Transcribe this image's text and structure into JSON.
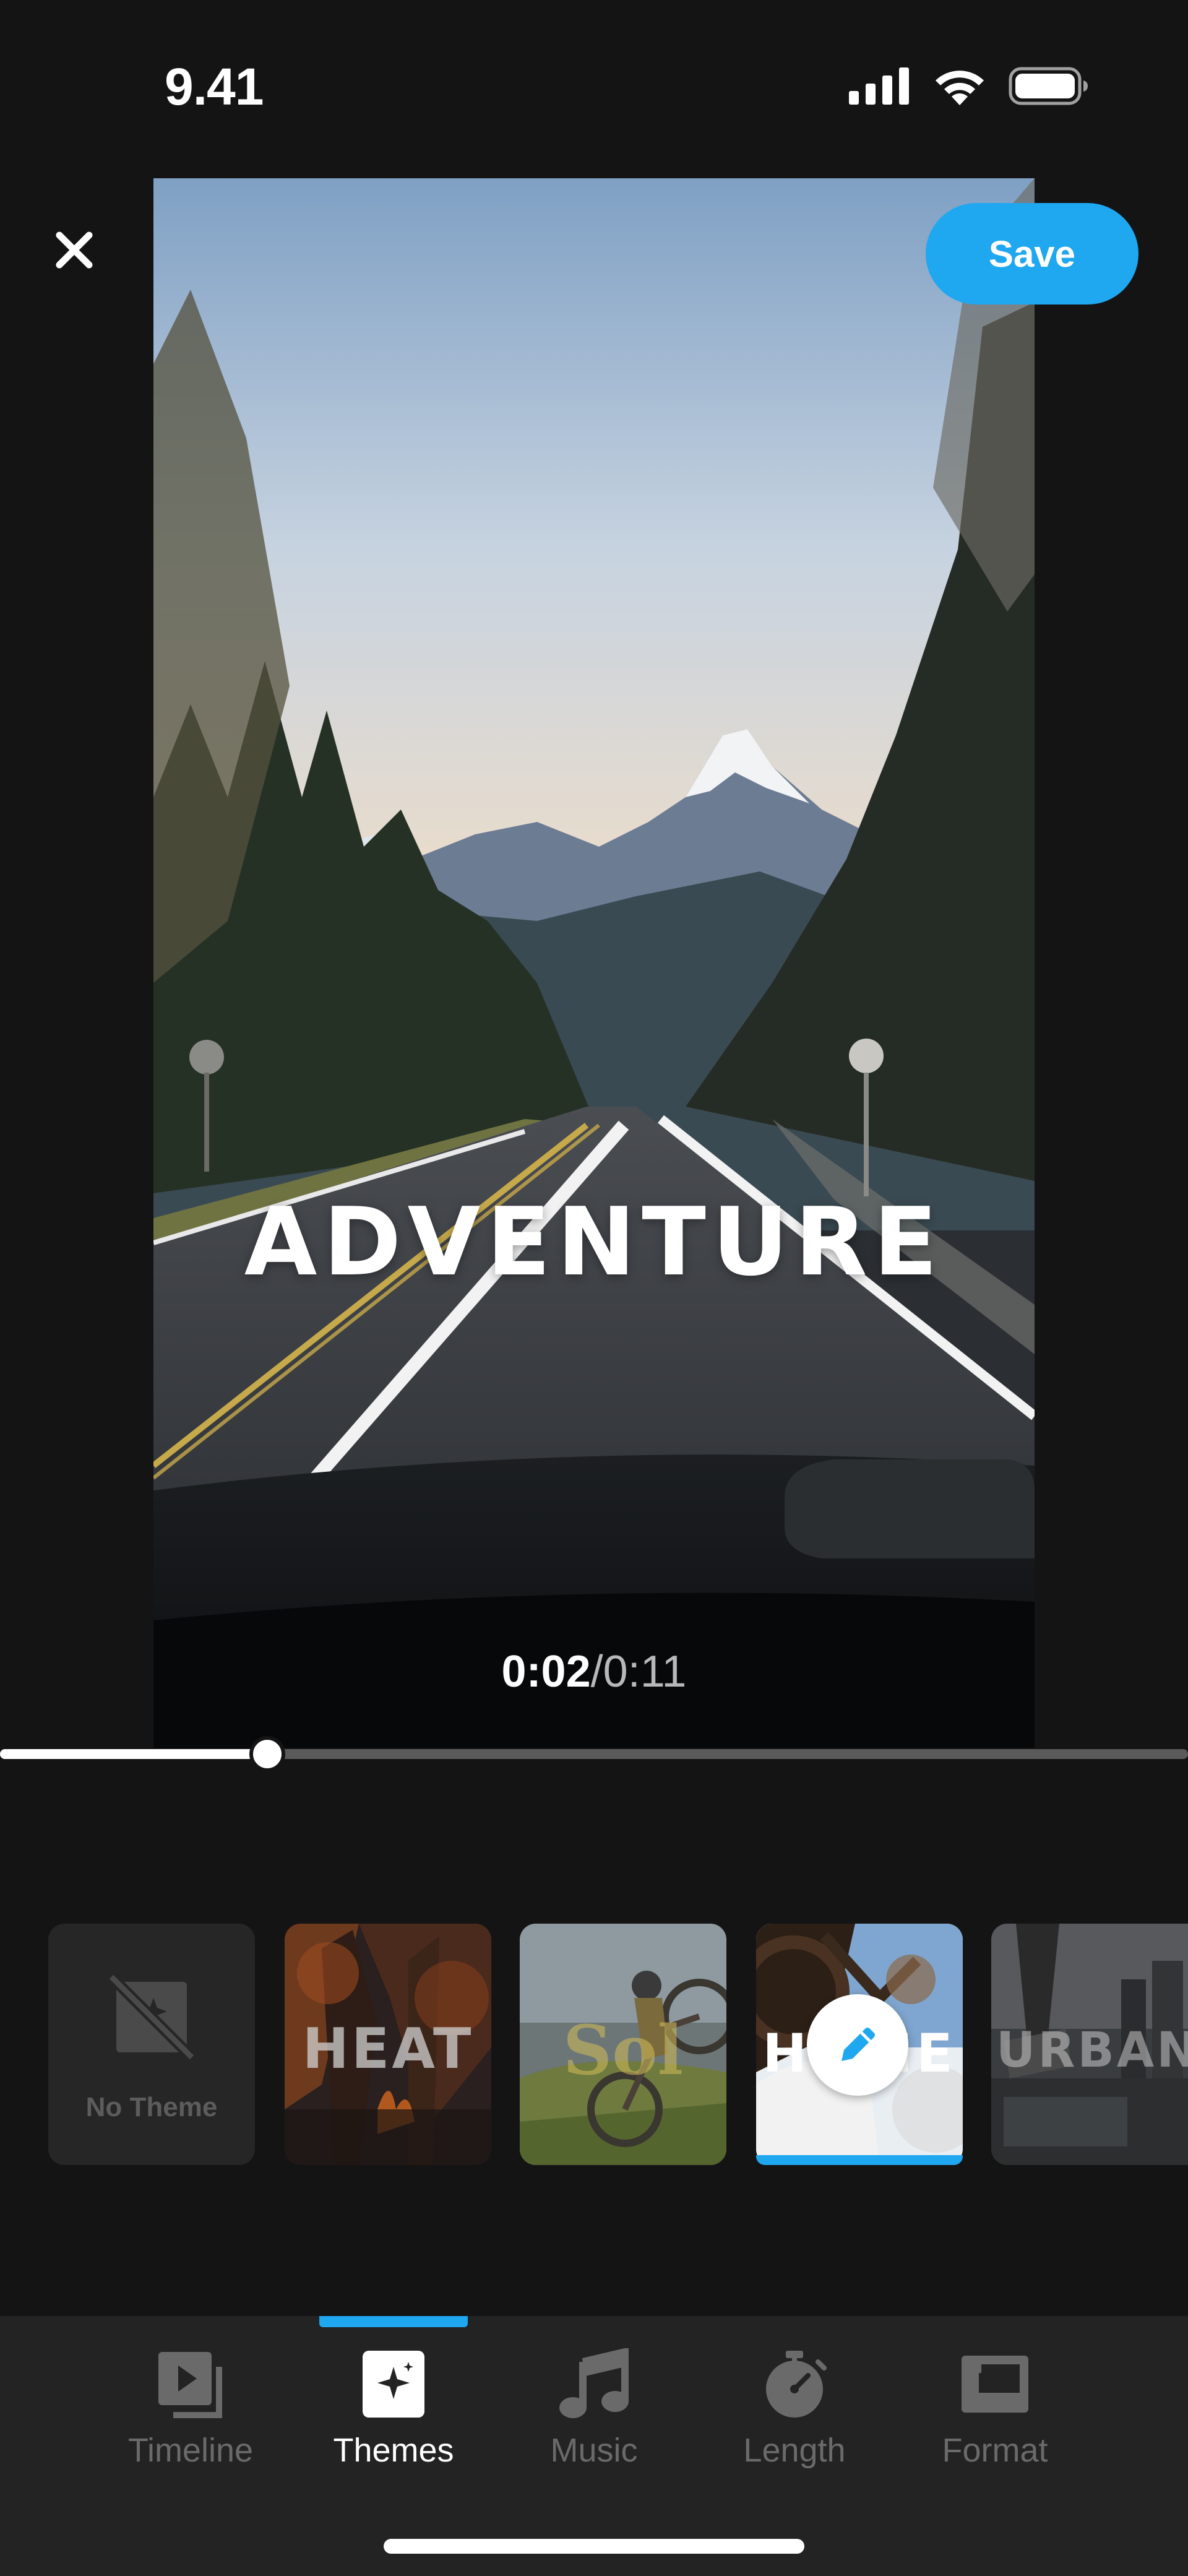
{
  "status_bar": {
    "time": "9.41"
  },
  "header": {
    "save_label": "Save"
  },
  "video": {
    "title": "ADVENTURE",
    "current_time": "0:02",
    "separator": "/",
    "duration": "0:11",
    "progress": 0.1
  },
  "themes": [
    {
      "label": "No Theme",
      "selected": false
    },
    {
      "label": "HEAT",
      "selected": false
    },
    {
      "label": "Sol",
      "selected": false
    },
    {
      "label": "HOME",
      "selected": true
    },
    {
      "label": "URBAN",
      "selected": false
    }
  ],
  "tabs": [
    {
      "label": "Timeline",
      "icon": "timeline-icon",
      "active": false
    },
    {
      "label": "Themes",
      "icon": "themes-sparkle-icon",
      "active": true
    },
    {
      "label": "Music",
      "icon": "music-note-icon",
      "active": false
    },
    {
      "label": "Length",
      "icon": "stopwatch-icon",
      "active": false
    },
    {
      "label": "Format",
      "icon": "format-icon",
      "active": false
    }
  ],
  "colors": {
    "accent": "#1fa7f0",
    "background": "#141414",
    "tabbar": "#232323",
    "inactive_label": "#6a6a6a"
  }
}
